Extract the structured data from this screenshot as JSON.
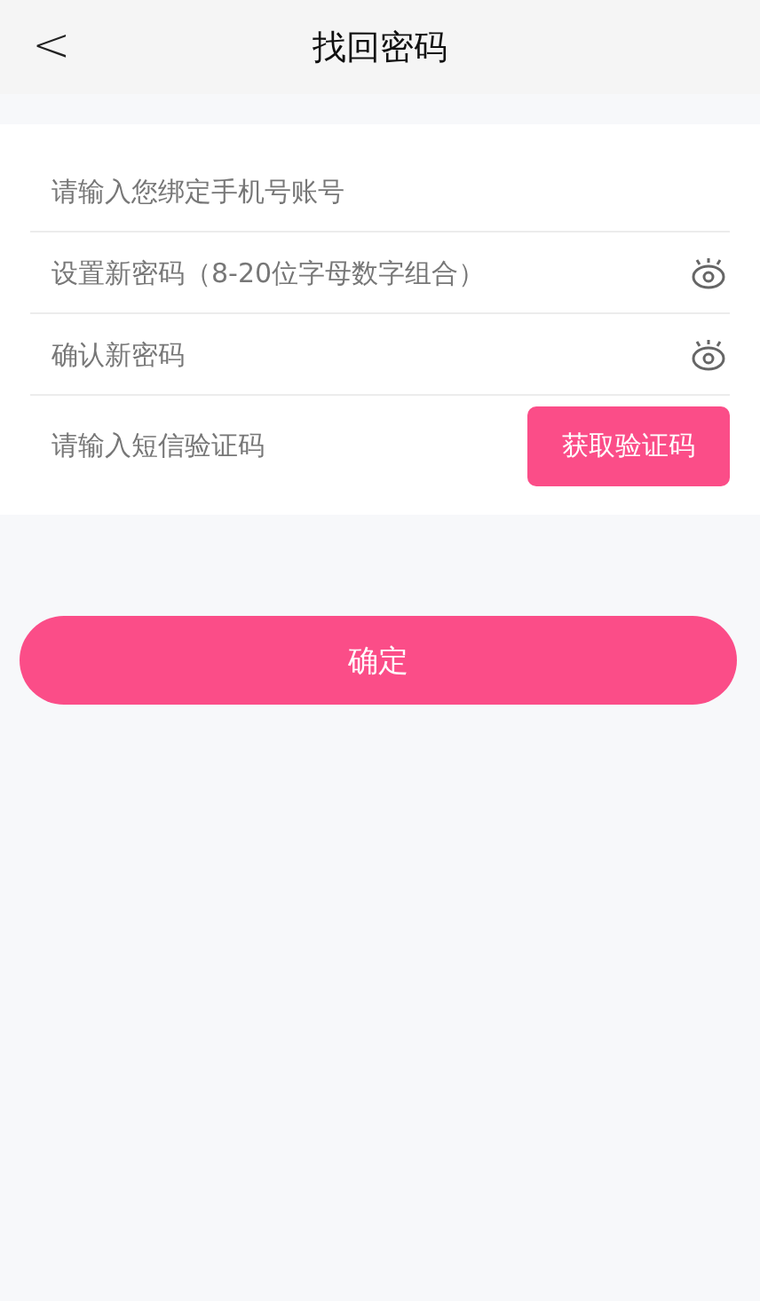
{
  "header": {
    "back": "<",
    "title": "找回密码"
  },
  "fields": [
    {
      "kind": "text",
      "placeholder": "请输入您绑定手机号账号"
    },
    {
      "kind": "password",
      "placeholder": "设置新密码（8-20位字母数字组合）"
    },
    {
      "kind": "password",
      "placeholder": "确认新密码"
    },
    {
      "kind": "code",
      "placeholder": "请输入短信验证码",
      "button": "获取验证码"
    }
  ],
  "submit": "确定"
}
